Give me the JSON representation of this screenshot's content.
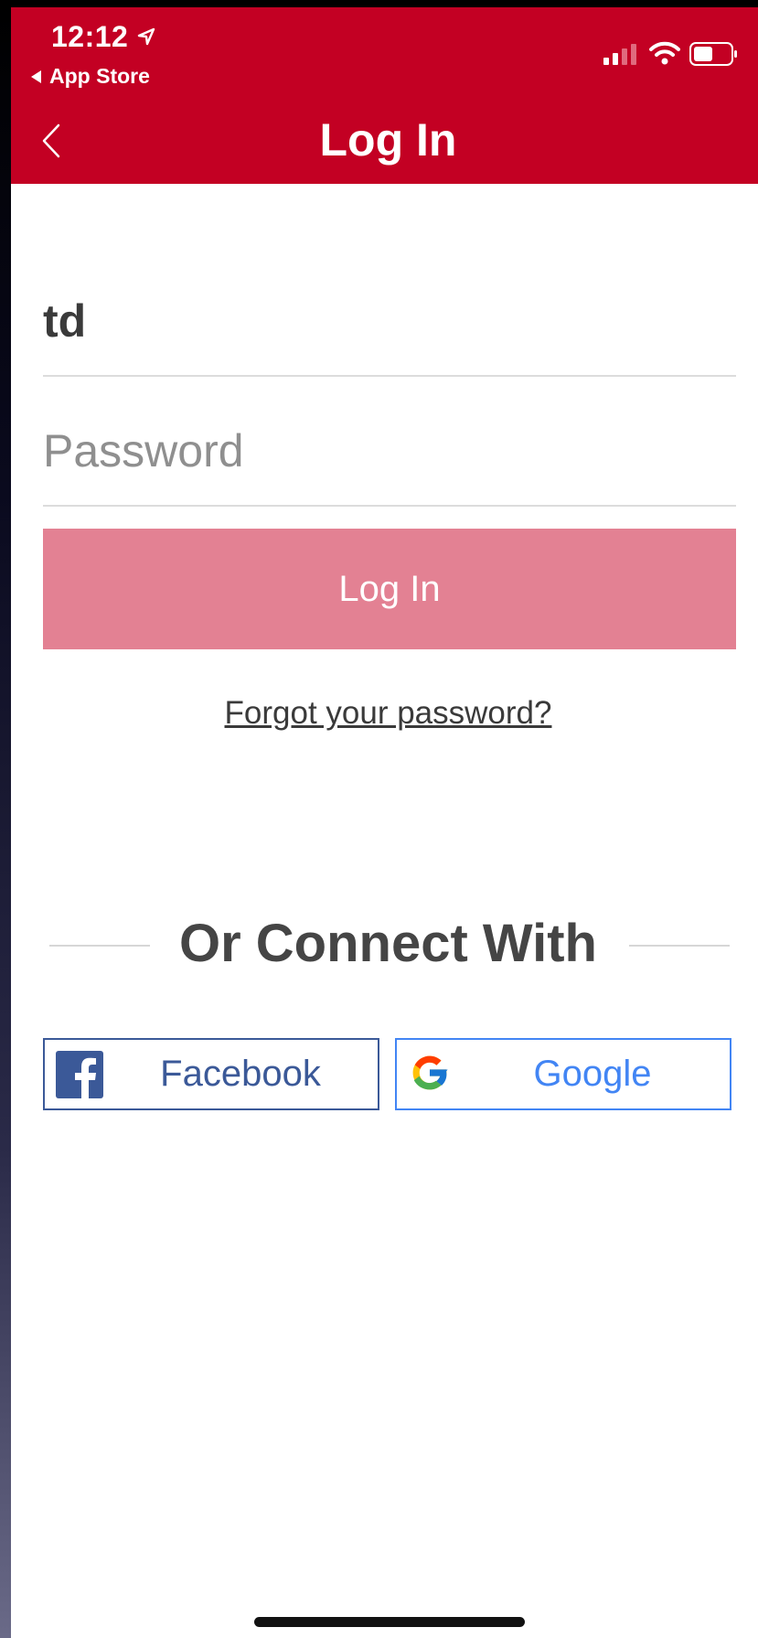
{
  "status_bar": {
    "time": "12:12",
    "back_to_app": "App Store"
  },
  "nav": {
    "title": "Log In"
  },
  "form": {
    "username_value": "td",
    "password_placeholder": "Password",
    "login_label": "Log In",
    "forgot_label": "Forgot your password?"
  },
  "social": {
    "divider_text": "Or Connect With",
    "facebook_label": "Facebook",
    "google_label": "Google"
  },
  "colors": {
    "brand_red": "#c30023",
    "login_button_disabled": "#e38193",
    "facebook_blue": "#3b5998",
    "google_blue": "#4285f4"
  },
  "icons": [
    "location-arrow-icon",
    "signal-icon",
    "wifi-icon",
    "battery-icon",
    "back-chevron-icon",
    "facebook-logo-icon",
    "google-logo-icon"
  ]
}
